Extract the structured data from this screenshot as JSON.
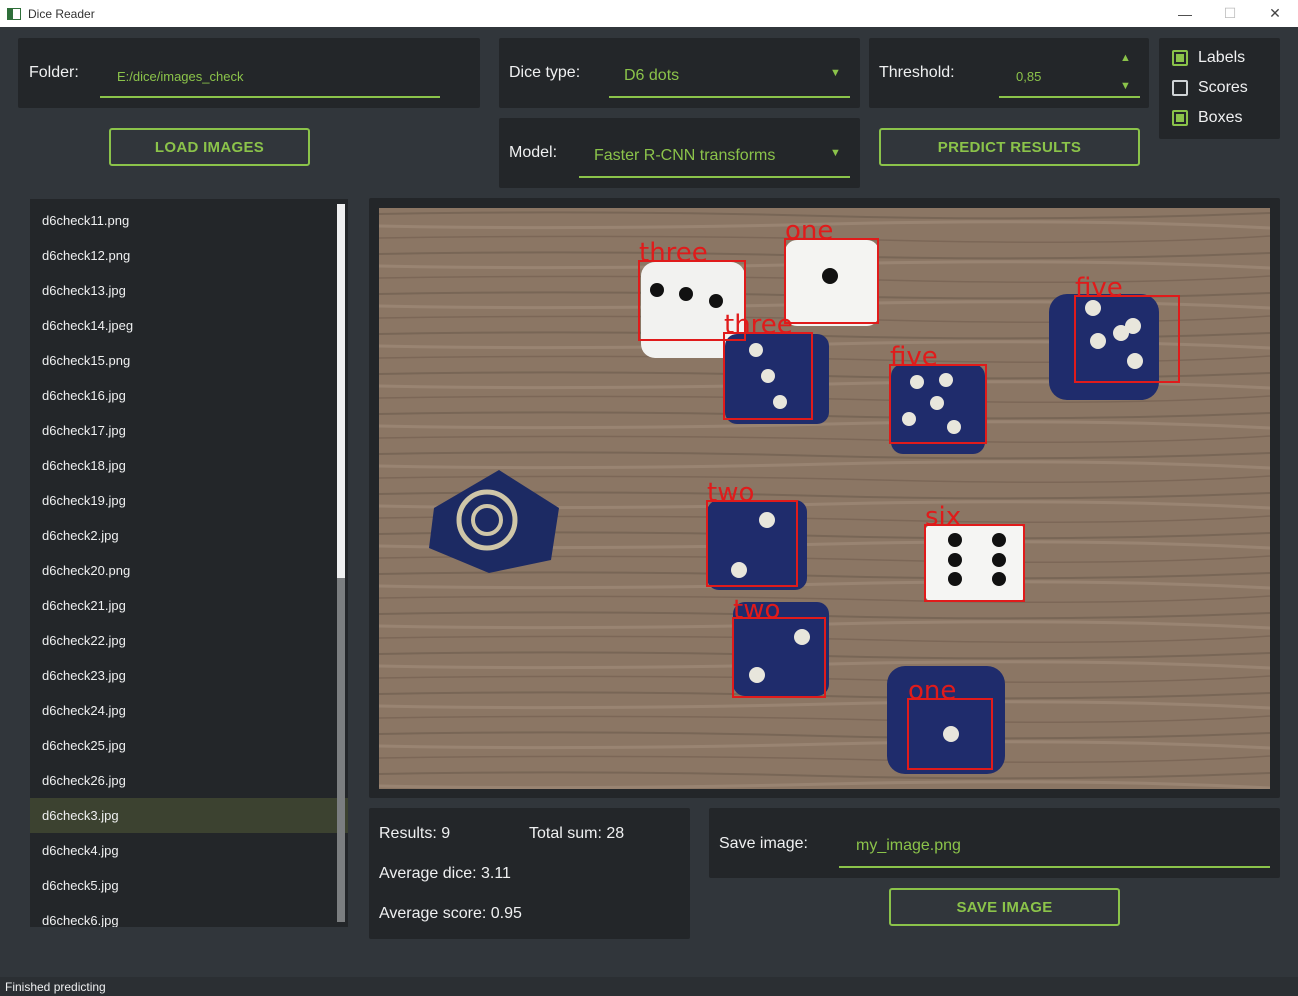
{
  "window": {
    "title": "Dice Reader",
    "controls": {
      "minimize": "—",
      "maximize": "☐",
      "close": "✕"
    }
  },
  "folder": {
    "label": "Folder:",
    "value": "E:/dice/images_check"
  },
  "load_button": "LOAD IMAGES",
  "dice_type": {
    "label": "Dice type:",
    "value": "D6 dots"
  },
  "model": {
    "label": "Model:",
    "value": "Faster R-CNN transforms"
  },
  "threshold": {
    "label": "Threshold:",
    "value": "0,85"
  },
  "predict_button": "PREDICT RESULTS",
  "options": [
    {
      "label": "Labels",
      "checked": true
    },
    {
      "label": "Scores",
      "checked": false
    },
    {
      "label": "Boxes",
      "checked": true
    }
  ],
  "files": [
    "d6check11.png",
    "d6check12.png",
    "d6check13.jpg",
    "d6check14.jpeg",
    "d6check15.png",
    "d6check16.jpg",
    "d6check17.jpg",
    "d6check18.jpg",
    "d6check19.jpg",
    "d6check2.jpg",
    "d6check20.png",
    "d6check21.jpg",
    "d6check22.jpg",
    "d6check23.jpg",
    "d6check24.jpg",
    "d6check25.jpg",
    "d6check26.jpg",
    "d6check3.jpg",
    "d6check4.jpg",
    "d6check5.jpg",
    "d6check6.jpg"
  ],
  "selected_file": "d6check3.jpg",
  "detections": [
    "three",
    "one",
    "three",
    "five",
    "five",
    "two",
    "six",
    "two",
    "one"
  ],
  "results": {
    "count": "Results: 9",
    "total": "Total sum: 28",
    "avg_dice": "Average dice: 3.11",
    "avg_score": "Average score: 0.95"
  },
  "save": {
    "label": "Save image:",
    "value": "my_image.png",
    "button": "SAVE IMAGE"
  },
  "status": "Finished predicting",
  "colors": {
    "accent": "#8bc34a",
    "box": "#e01b1b",
    "background": "#31363b",
    "panel": "#232629"
  }
}
